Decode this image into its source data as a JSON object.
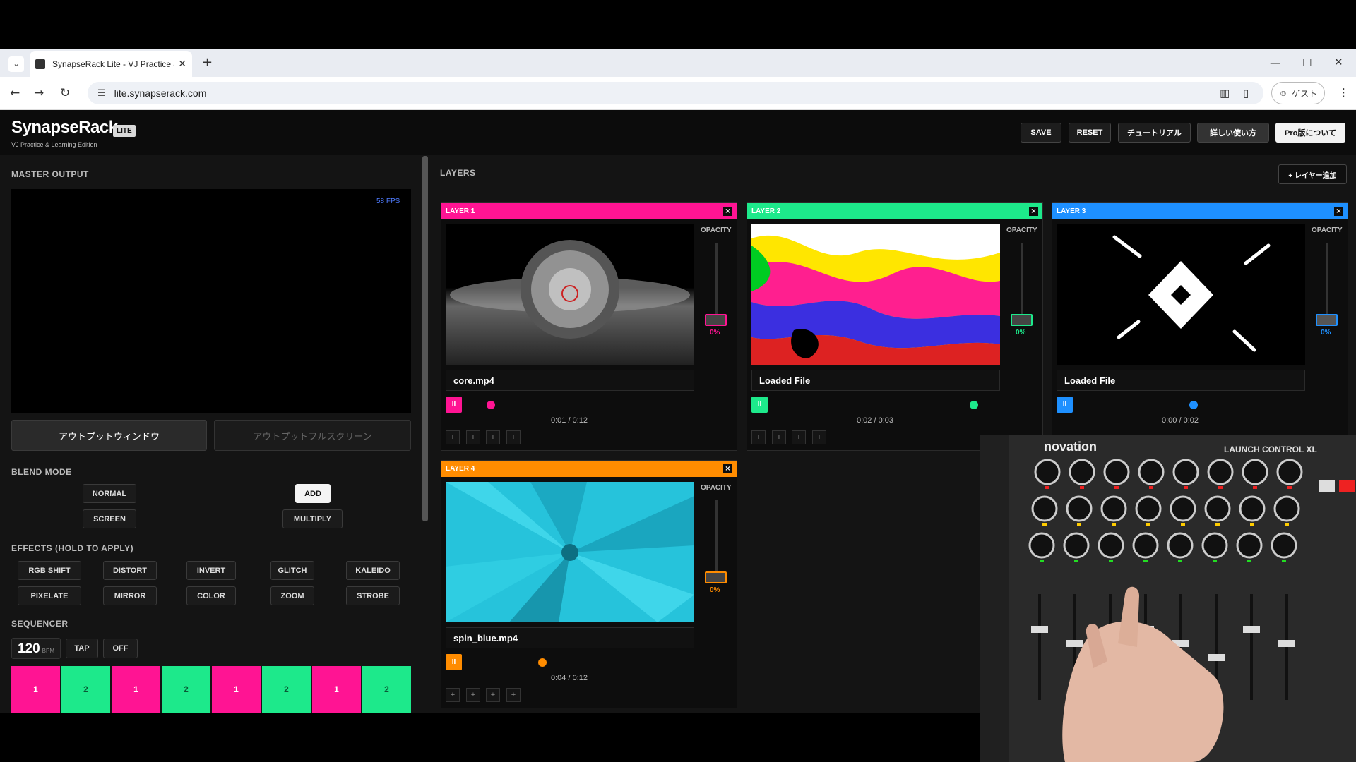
{
  "browser": {
    "tab_title": "SynapseRack Lite - VJ Practice &",
    "url": "lite.synapserack.com",
    "guest_label": "ゲスト"
  },
  "app": {
    "brand": "SynapseRack",
    "badge": "LITE",
    "subtitle": "VJ Practice & Learning Edition",
    "header_buttons": {
      "save": "SAVE",
      "reset": "RESET",
      "tutorial": "チュートリアル",
      "howto": "詳しい使い方",
      "pro": "Pro版について"
    }
  },
  "master": {
    "title": "MASTER OUTPUT",
    "fps": "58 FPS",
    "output_window": "アウトプットウィンドウ",
    "output_fullscreen": "アウトプットフルスクリーン"
  },
  "blend": {
    "title": "BLEND MODE",
    "normal": "NORMAL",
    "add": "ADD",
    "screen": "SCREEN",
    "multiply": "MULTIPLY"
  },
  "effects": {
    "title": "EFFECTS (HOLD TO APPLY)",
    "items": [
      "RGB SHIFT",
      "DISTORT",
      "INVERT",
      "GLITCH",
      "KALEIDO",
      "PIXELATE",
      "MIRROR",
      "COLOR",
      "ZOOM",
      "STROBE"
    ]
  },
  "sequencer": {
    "title": "SEQUENCER",
    "bpm": "120",
    "bpm_unit": "BPM",
    "tap": "TAP",
    "off": "OFF",
    "steps": [
      "1",
      "2",
      "1",
      "2",
      "1",
      "2",
      "1",
      "2"
    ]
  },
  "layers_panel": {
    "title": "LAYERS",
    "add_layer": "+ レイヤー追加"
  },
  "layers": [
    {
      "label": "LAYER 1",
      "color": "#ff1493",
      "opacity_label": "OPACITY",
      "opacity": "0%",
      "file": "core.mp4",
      "time": "0:01 / 0:12",
      "pause": "II",
      "close": "×"
    },
    {
      "label": "LAYER 2",
      "color": "#1de98b",
      "opacity_label": "OPACITY",
      "opacity": "0%",
      "file": "Loaded File",
      "time": "0:02 / 0:03",
      "pause": "II",
      "close": "×"
    },
    {
      "label": "LAYER 3",
      "color": "#1e90ff",
      "opacity_label": "OPACITY",
      "opacity": "0%",
      "file": "Loaded File",
      "time": "0:00 / 0:02",
      "pause": "II",
      "close": "×"
    },
    {
      "label": "LAYER 4",
      "color": "#ff8c00",
      "opacity_label": "OPACITY",
      "opacity": "0%",
      "file": "spin_blue.mp4",
      "time": "0:04 / 0:12",
      "pause": "II",
      "close": "×"
    }
  ],
  "overlay": {
    "controller_brand": "novation",
    "controller_model": "LAUNCH CONTROL XL"
  },
  "colors": {
    "pink": "#ff1493",
    "green": "#1de98b",
    "blue": "#1e90ff",
    "orange": "#ff8c00",
    "fps": "#4f7cff"
  },
  "icons": [
    "tab-list-icon",
    "page-icon",
    "close-icon",
    "plus-icon",
    "back-icon",
    "forward-icon",
    "reload-icon",
    "tune-icon",
    "reading-icon",
    "document-icon",
    "account-icon",
    "more-icon"
  ]
}
